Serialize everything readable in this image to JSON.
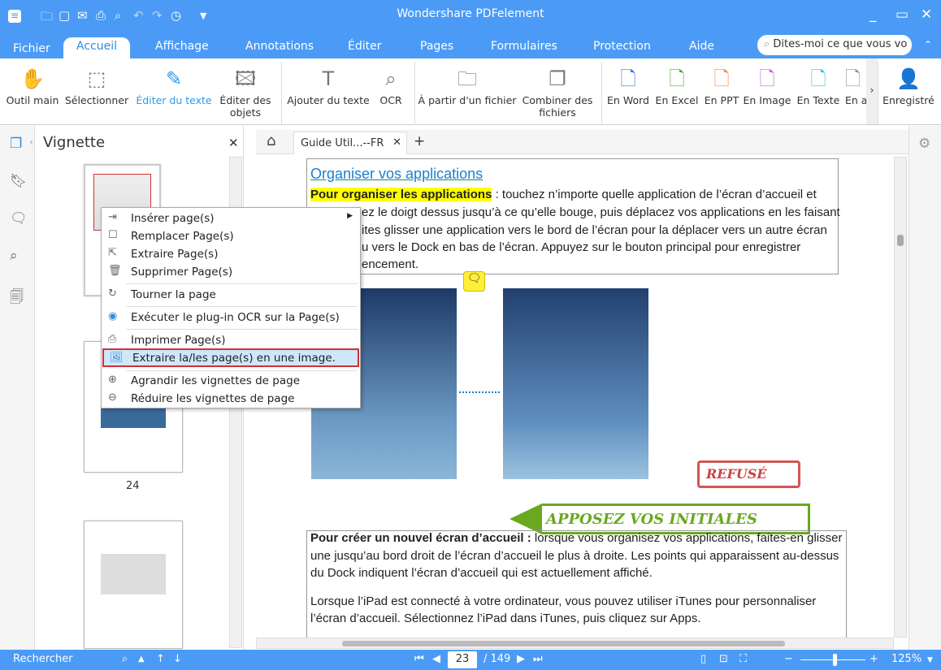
{
  "app": {
    "title": "Wondershare PDFelement",
    "accent": "#4b9bf6"
  },
  "quick_access": [
    "app-menu-icon",
    "open-icon",
    "save-icon",
    "email-icon",
    "print-icon",
    "print-preview-icon",
    "undo-icon",
    "redo-icon",
    "history-icon",
    "customize-icon"
  ],
  "tabs": [
    "Fichier",
    "Accueil",
    "Affichage",
    "Annotations",
    "Éditer",
    "Pages",
    "Formulaires",
    "Protection",
    "Aide"
  ],
  "search_placeholder": "Dites-moi ce que vous vo",
  "ribbon": [
    "Outil main",
    "Sélectionner",
    "Éditer du texte",
    "Éditer des objets",
    "Ajouter du texte",
    "OCR",
    "À partir d'un fichier",
    "Combiner des fichiers",
    "En Word",
    "En Excel",
    "En PPT",
    "En Image",
    "En Texte",
    "En a",
    "Enregistré"
  ],
  "panel": {
    "title": "Vignette",
    "page_label": "24"
  },
  "doc_tab": "Guide Util...--FR",
  "context_menu": [
    "Insérer page(s)",
    "Remplacer Page(s)",
    "Extraire Page(s)",
    "Supprimer Page(s)",
    "Tourner la page",
    "Exécuter le plug-in OCR sur la Page(s)",
    "Imprimer Page(s)",
    "Extraire la/les page(s) en une image.",
    "Agrandir les vignettes de page",
    "Réduire les vignettes de page"
  ],
  "document": {
    "heading": "Organiser vos applications",
    "p1_bold": "Pour organiser les applications",
    "p1_lines": [
      " : touchez n’importe quelle application de l’écran d’accueil et",
      "ez le doigt dessus jusqu’à ce qu’elle bouge, puis déplacez vos applications en les faisant",
      "ites glisser une application vers le bord de l’écran pour la déplacer vers un autre écran",
      "u vers le Dock en bas de l’écran. Appuyez sur le bouton principal pour enregistrer",
      "encement."
    ],
    "stamp_refuse": "REFUSÉ",
    "stamp_initials": "APPOSEZ VOS INITIALES",
    "p2_bold": "Pour créer un nouvel écran d’accueil :",
    "p2_lines": [
      " lorsque vous organisez vos applications, faites-en glisser",
      "une jusqu’au bord droit de l’écran d’accueil le plus à droite. Les points qui apparaissent au-dessus",
      "du Dock indiquent l’écran d’accueil qui est actuellement affiché."
    ],
    "p3_lines": [
      "Lorsque l’iPad est connecté à votre ordinateur, vous pouvez utiliser iTunes pour personnaliser",
      "l’écran d’accueil. Sélectionnez l’iPad dans iTunes, puis cliquez sur Apps."
    ]
  },
  "status": {
    "search_label": "Rechercher",
    "current_page": "23",
    "total_pages": "/ 149",
    "zoom": "125%",
    "zoom_level_percent": 125
  }
}
